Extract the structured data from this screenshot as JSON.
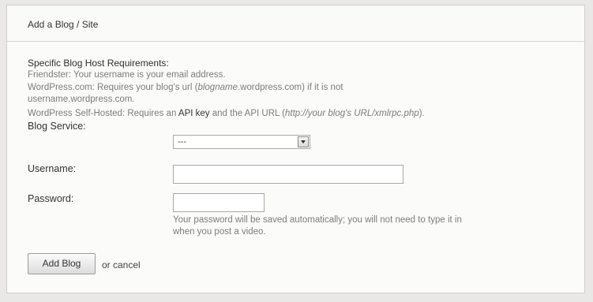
{
  "title": "Add a Blog / Site",
  "requirements": {
    "heading": "Specific Blog Host Requirements:",
    "friendster": "Friendster: Your username is your email address.",
    "wordpress_prefix": "WordPress.com: Requires your blog's url (",
    "wordpress_italic": "blogname",
    "wordpress_suffix": ".wordpress.com) if it is not",
    "wordpress_line2": "username.wordpress.com.",
    "selfhosted_prefix": "WordPress Self-Hosted: Requires an ",
    "selfhosted_api_key": "API key",
    "selfhosted_middle": " and the API URL (",
    "selfhosted_url": "http://your blog's URL/xmlrpc.php",
    "selfhosted_suffix": ")."
  },
  "form": {
    "blog_service_label": "Blog Service:",
    "blog_service_value": "---",
    "username_label": "Username:",
    "username_value": "",
    "password_label": "Password:",
    "password_value": "",
    "password_note_line1": "Your password will be saved automatically; you will not need to type it in",
    "password_note_line2": "when you post a video."
  },
  "actions": {
    "add_blog_label": "Add Blog",
    "cancel_text": "or cancel"
  }
}
